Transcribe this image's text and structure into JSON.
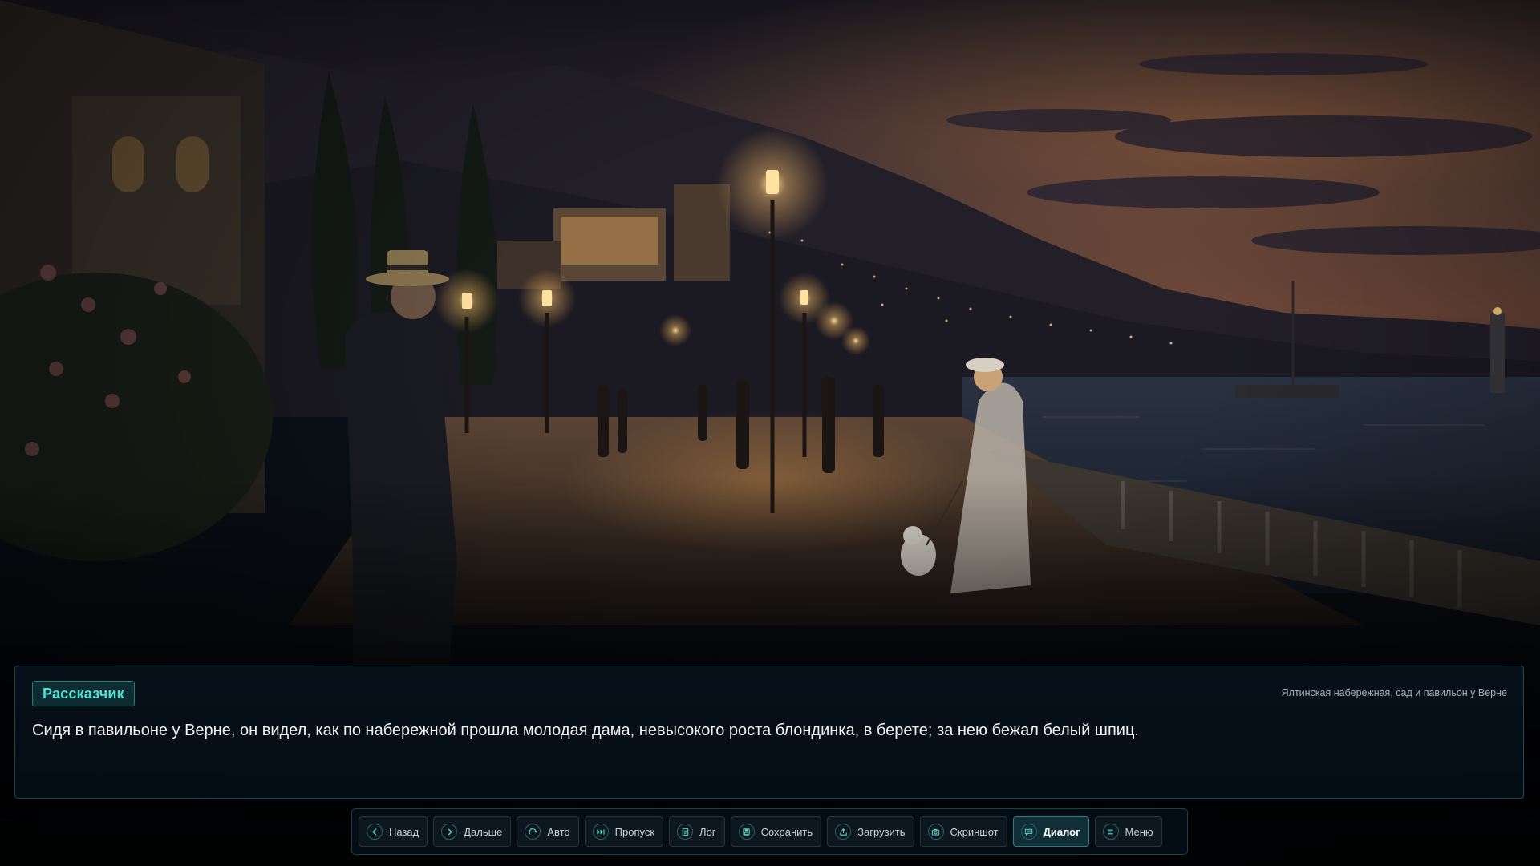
{
  "scene": {
    "name": "yalta-embankment-evening",
    "colors": {
      "sky_top": "#1b1a24",
      "sky_glow": "#b36a3e",
      "mountain": "#201d26",
      "sea": "#1f2a38",
      "promenade": "#3a2e24",
      "lamp_light": "#ffd27a"
    }
  },
  "dialog": {
    "speaker": "Рассказчик",
    "location": "Ялтинская набережная, сад и павильон у Верне",
    "text": "Сидя в павильоне у Верне, он видел, как по набережной прошла молодая дама, невысокого роста блондинка, в берете; за нею бежал белый шпиц.",
    "accent_color": "#4fe3d6"
  },
  "controls": [
    {
      "label": "Назад",
      "icon": "arrow-left-icon",
      "active": false
    },
    {
      "label": "Дальше",
      "icon": "arrow-right-icon",
      "active": false
    },
    {
      "label": "Авто",
      "icon": "auto-play-icon",
      "active": false
    },
    {
      "label": "Пропуск",
      "icon": "skip-icon",
      "active": false
    },
    {
      "label": "Лог",
      "icon": "log-icon",
      "active": false
    },
    {
      "label": "Сохранить",
      "icon": "save-icon",
      "active": false
    },
    {
      "label": "Загрузить",
      "icon": "load-icon",
      "active": false
    },
    {
      "label": "Скриншот",
      "icon": "camera-icon",
      "active": false
    },
    {
      "label": "Диалог",
      "icon": "dialog-icon",
      "active": true
    },
    {
      "label": "Меню",
      "icon": "menu-icon",
      "active": false
    }
  ]
}
